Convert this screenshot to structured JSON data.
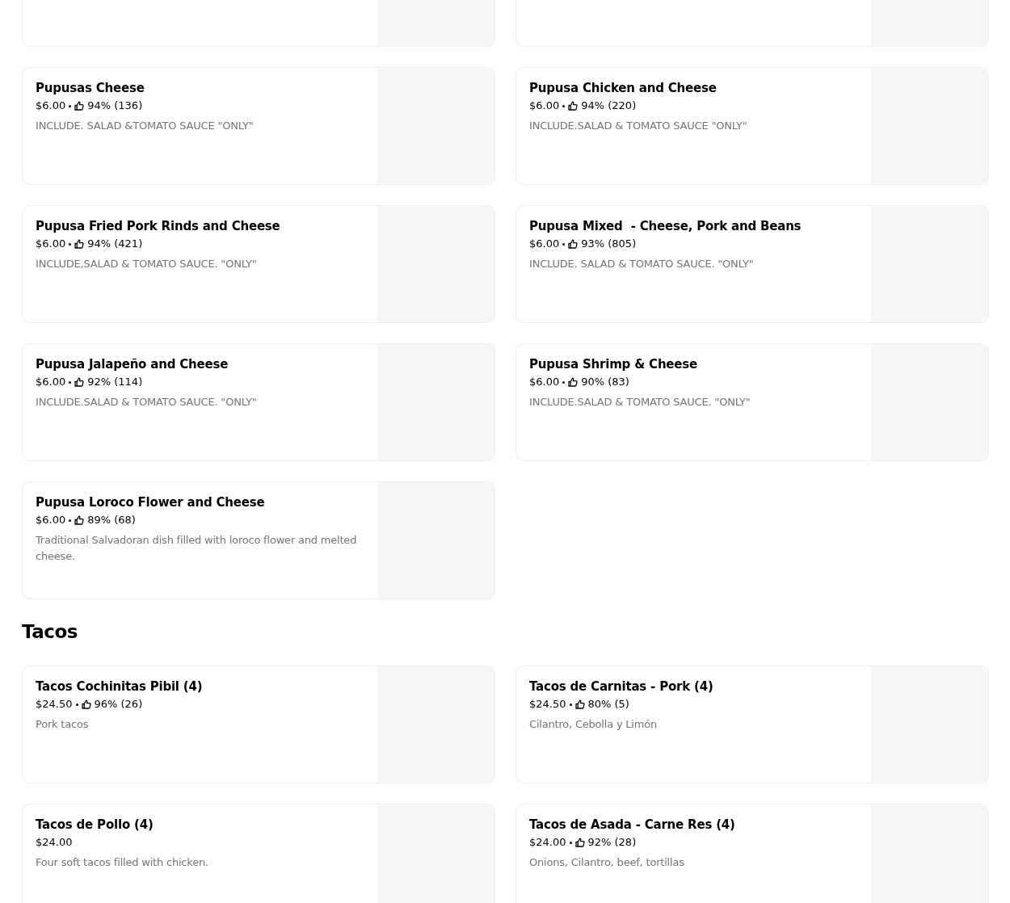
{
  "sections": [
    {
      "items": [
        {
          "kind": "cut_off"
        },
        {
          "kind": "cut_off"
        },
        {
          "kind": "item",
          "name": "Pupusas Cheese",
          "price": "$6.00",
          "rating": "94% (136)",
          "description": "INCLUDE. SALAD &TOMATO SAUCE \"ONLY\""
        },
        {
          "kind": "item",
          "name": "Pupusa Chicken and Cheese",
          "price": "$6.00",
          "rating": "94% (220)",
          "description": "INCLUDE.SALAD & TOMATO SAUCE \"ONLY\""
        },
        {
          "kind": "item",
          "name": "Pupusa Fried Pork Rinds and Cheese",
          "price": "$6.00",
          "rating": "94% (421)",
          "description": "INCLUDE,SALAD & TOMATO SAUCE. \"ONLY\""
        },
        {
          "kind": "item",
          "name": "Pupusa Mixed  - Cheese, Pork and Beans",
          "price": "$6.00",
          "rating": "93% (805)",
          "description": "INCLUDE. SALAD & TOMATO SAUCE. \"ONLY\""
        },
        {
          "kind": "item",
          "name": "Pupusa Jalapeño and Cheese",
          "price": "$6.00",
          "rating": "92% (114)",
          "description": "INCLUDE.SALAD & TOMATO SAUCE. \"ONLY\""
        },
        {
          "kind": "item",
          "name": "Pupusa Shrimp & Cheese",
          "price": "$6.00",
          "rating": "90% (83)",
          "description": "INCLUDE.SALAD & TOMATO SAUCE. \"ONLY\""
        },
        {
          "kind": "item",
          "name": "Pupusa Loroco Flower and Cheese",
          "price": "$6.00",
          "rating": "89% (68)",
          "description": "Traditional Salvadoran dish filled with loroco flower and melted cheese."
        }
      ]
    },
    {
      "title": "Tacos",
      "items": [
        {
          "kind": "item",
          "name": "Tacos Cochinitas Pibil (4)",
          "price": "$24.50",
          "rating": "96% (26)",
          "description": "Pork tacos"
        },
        {
          "kind": "item",
          "name": "Tacos de Carnitas - Pork (4)",
          "price": "$24.50",
          "rating": "80% (5)",
          "description": "Cilantro, Cebolla y Limón"
        },
        {
          "kind": "item",
          "name": "Tacos de Pollo (4)",
          "price": "$24.00",
          "description": "Four soft tacos filled with chicken."
        },
        {
          "kind": "item",
          "name": "Tacos de Asada - Carne Res (4)",
          "price": "$24.00",
          "rating": "92% (28)",
          "description": "Onions, Cilantro, beef, tortillas"
        }
      ]
    }
  ]
}
